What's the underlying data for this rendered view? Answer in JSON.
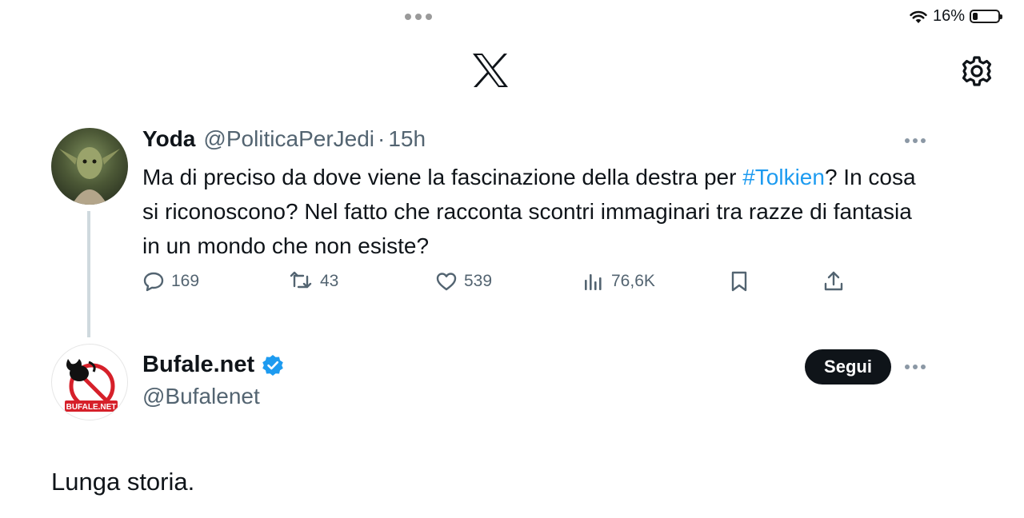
{
  "status": {
    "battery_pct": "16%",
    "battery_level": 0.16
  },
  "icons": {
    "wifi": "wifi-icon",
    "battery": "battery-icon",
    "logo": "x-logo-icon",
    "settings": "gear-icon",
    "reply": "speech-bubble-icon",
    "retweet": "retweet-icon",
    "like": "heart-icon",
    "views": "bar-chart-icon",
    "bookmark": "bookmark-icon",
    "share": "share-icon",
    "more": "ellipsis-icon",
    "verified": "verified-badge-icon"
  },
  "colors": {
    "text": "#0f1419",
    "muted": "#536471",
    "link": "#1d9bf0",
    "verified": "#1d9bf0",
    "follow_bg": "#0f1419"
  },
  "tweet1": {
    "author": "Yoda",
    "handle": "@PoliticaPerJedi",
    "separator": "·",
    "time": "15h",
    "text_before": "Ma di preciso da dove viene la fascinazione della destra per ",
    "hashtag": "#Tolkien",
    "text_after": "? In cosa si riconoscono? Nel fatto che racconta scontri immaginari tra razze di fantasia in un mondo che non esiste?",
    "replies": "169",
    "retweets": "43",
    "likes": "539",
    "views": "76,6K"
  },
  "tweet2": {
    "author": "Bufale.net",
    "handle": "@Bufalenet",
    "follow_label": "Segui",
    "avatar_text": "BUFALE.NET",
    "text": "Lunga storia."
  }
}
